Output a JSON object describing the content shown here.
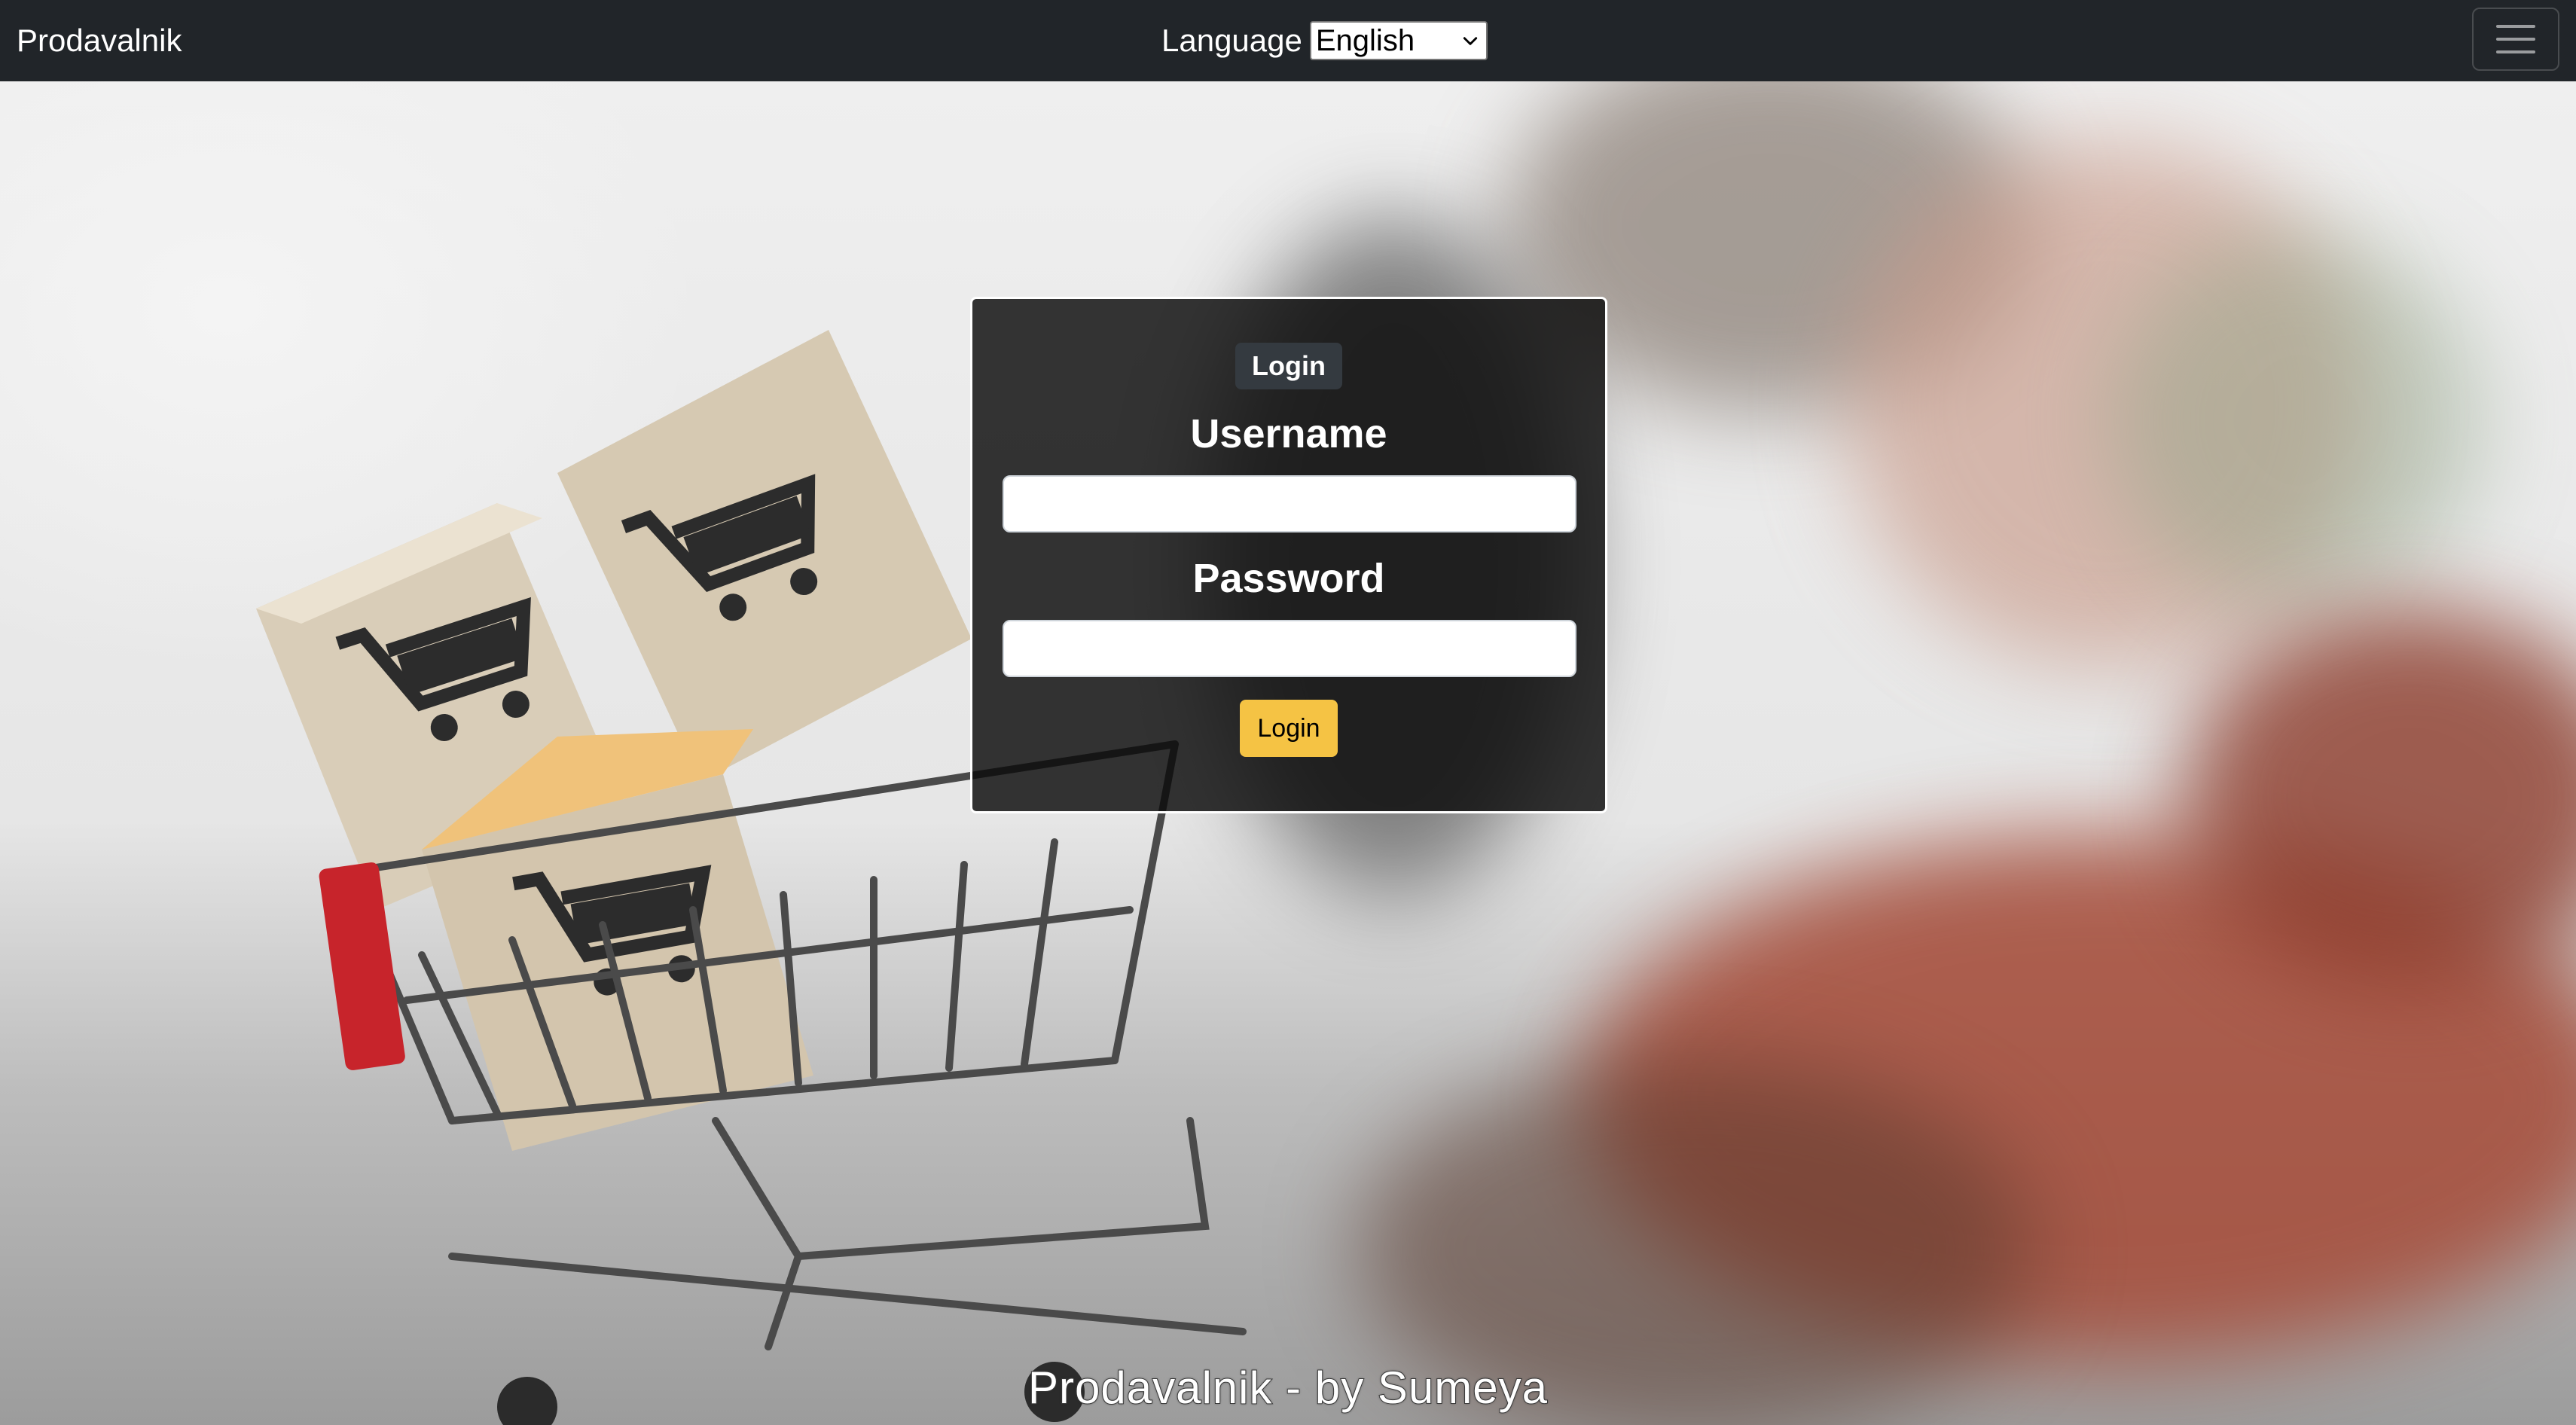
{
  "navbar": {
    "brand": "Prodavalnik",
    "language_label": "Language",
    "language_selected": "English",
    "toggler_icon": "hamburger-icon"
  },
  "login_card": {
    "badge": "Login",
    "username_label": "Username",
    "username_value": "",
    "password_label": "Password",
    "password_value": "",
    "submit_label": "Login"
  },
  "footer": {
    "text": "Prodavalnik - by Sumeya"
  },
  "colors": {
    "navbar_bg": "#212529",
    "login_button": "#f5c344",
    "badge_bg": "#343a40",
    "card_bg": "rgba(10,10,10,0.82)"
  }
}
